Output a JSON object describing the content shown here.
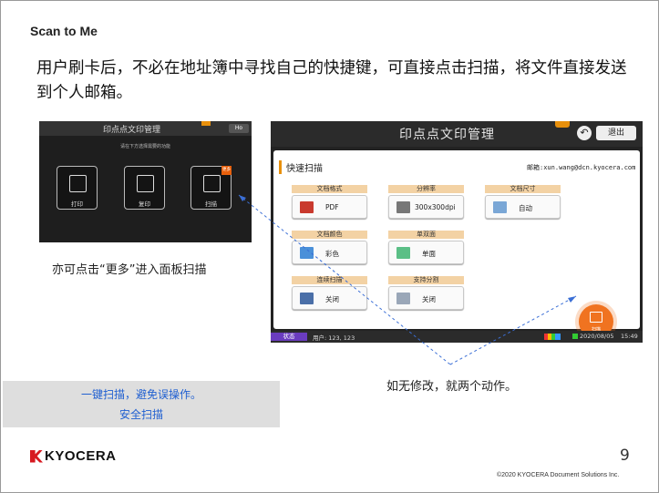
{
  "slide": {
    "section_title": "Scan to Me",
    "headline": "用户刷卡后，不必在地址簿中寻找自己的快捷键，可直接点击扫描，将文件直接发送到个人邮箱。",
    "caption_left": "亦可点击“更多”进入面板扫描",
    "caption_right": "如无修改，就两个动作。",
    "note_lines": [
      "一键扫描，避免误操作。",
      "安全扫描"
    ],
    "page_number": "9",
    "copyright": "©2020 KYOCERA Document Solutions Inc.",
    "logo_text": "KYOCERA"
  },
  "left_panel": {
    "title": "印点点文印管理",
    "exit_label": "Ho",
    "subtitle": "请在下方选择需要的功能",
    "tiles": [
      {
        "label": "打印",
        "icon": "printer-icon"
      },
      {
        "label": "复印",
        "icon": "copy-icon"
      },
      {
        "label": "扫描",
        "icon": "scan-icon",
        "badge": "更多"
      }
    ]
  },
  "right_panel": {
    "title": "印点点文印管理",
    "exit_label": "退出",
    "section_title": "快速扫描",
    "email": "邮箱:xun.wang@dcn.kyocera.com",
    "options": [
      {
        "header": "文档格式",
        "value": "PDF",
        "icon_color": "#c93a2e"
      },
      {
        "header": "分辨率",
        "value": "300x300dpi",
        "icon_color": "#777777"
      },
      {
        "header": "文档尺寸",
        "value": "自动",
        "icon_color": "#7aa7d6"
      },
      {
        "header": "文档颜色",
        "value": "彩色",
        "icon_color": "#4a90d9"
      },
      {
        "header": "单双面",
        "value": "单面",
        "icon_color": "#5bbf86"
      },
      {
        "header": "连续扫描",
        "value": "关闭",
        "icon_color": "#4a6fa8"
      },
      {
        "header": "支持分割",
        "value": "关闭",
        "icon_color": "#9aa7b8"
      }
    ],
    "fab_label": "扫描",
    "status_tag": "状态",
    "user": "用户: 123, 123",
    "date": "2020/08/05",
    "time": "15:49"
  },
  "colors": {
    "accent": "#e8900c",
    "note_text": "#1f5fd1",
    "fab": "#f07320",
    "status_tag": "#6a3cbf"
  }
}
